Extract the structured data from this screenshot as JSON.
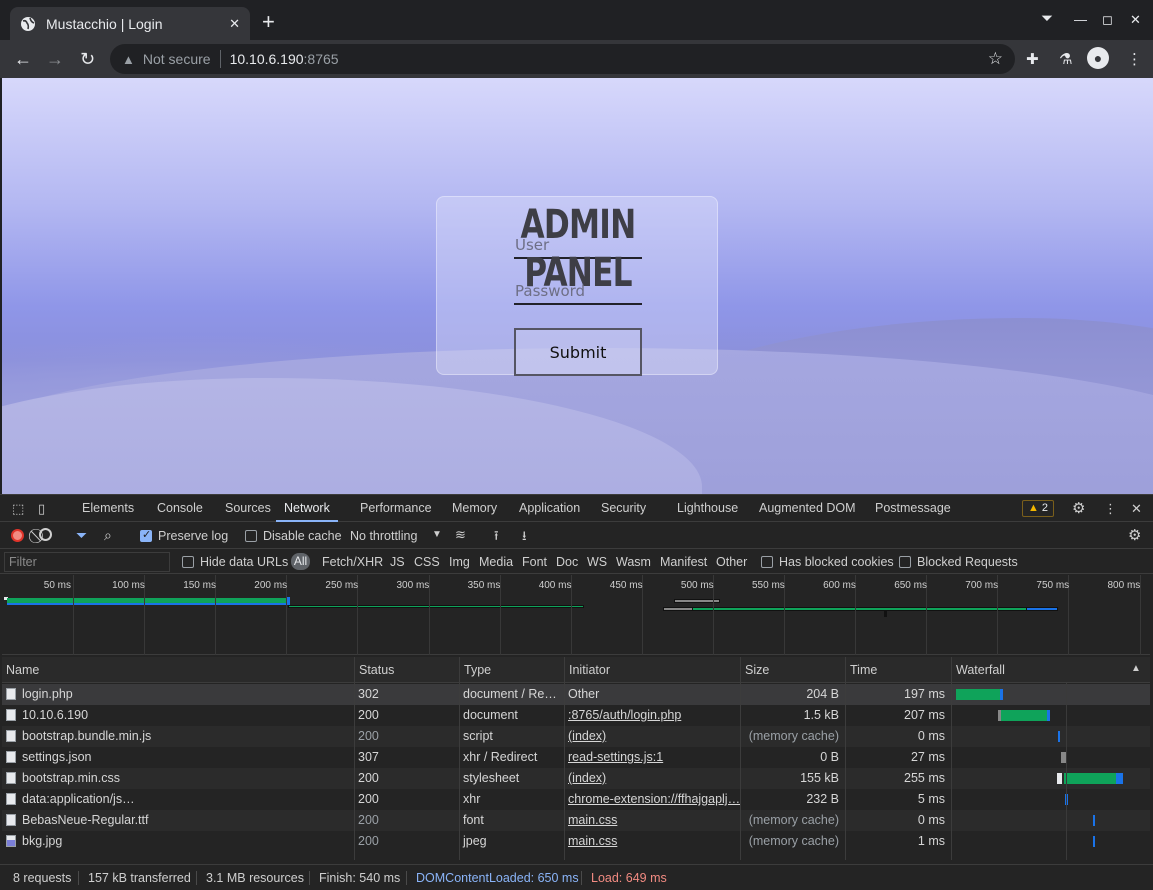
{
  "browser": {
    "tab_title": "Mustacchio | Login",
    "new_tab_label": "+",
    "security_label": "Not secure",
    "url_host": "10.10.6.190",
    "url_port": ":8765"
  },
  "login": {
    "title": "ADMIN PANEL",
    "user_placeholder": "User",
    "password_placeholder": "Password",
    "submit_label": "Submit"
  },
  "devtools": {
    "tabs": [
      "Elements",
      "Console",
      "Sources",
      "Network",
      "Performance",
      "Memory",
      "Application",
      "Security",
      "Lighthouse",
      "Augmented DOM",
      "Postmessage"
    ],
    "active_tab": "Network",
    "warning_count": "2",
    "toolbar": {
      "preserve_log": "Preserve log",
      "disable_cache": "Disable cache",
      "throttling": "No throttling"
    },
    "filter": {
      "placeholder": "Filter",
      "hide_data_urls": "Hide data URLs",
      "all": "All",
      "types": [
        "Fetch/XHR",
        "JS",
        "CSS",
        "Img",
        "Media",
        "Font",
        "Doc",
        "WS",
        "Wasm",
        "Manifest",
        "Other"
      ],
      "has_blocked_cookies": "Has blocked cookies",
      "blocked_requests": "Blocked Requests"
    },
    "overview_ticks": [
      "50 ms",
      "100 ms",
      "150 ms",
      "200 ms",
      "250 ms",
      "300 ms",
      "350 ms",
      "400 ms",
      "450 ms",
      "500 ms",
      "550 ms",
      "600 ms",
      "650 ms",
      "700 ms",
      "750 ms",
      "800 ms"
    ],
    "columns": [
      "Name",
      "Status",
      "Type",
      "Initiator",
      "Size",
      "Time",
      "Waterfall"
    ],
    "requests": [
      {
        "name": "login.php",
        "status": "302",
        "type": "document / Re…",
        "initiator": "Other",
        "size": "204 B",
        "time": "197 ms",
        "icon": "file"
      },
      {
        "name": "10.10.6.190",
        "status": "200",
        "type": "document",
        "initiator": ":8765/auth/login.php",
        "size": "1.5 kB",
        "time": "207 ms",
        "icon": "file"
      },
      {
        "name": "bootstrap.bundle.min.js",
        "status": "200",
        "type": "script",
        "initiator": "(index)",
        "size": "(memory cache)",
        "time": "0 ms",
        "icon": "file"
      },
      {
        "name": "settings.json",
        "status": "307",
        "type": "xhr / Redirect",
        "initiator": "read-settings.js:1",
        "size": "0 B",
        "time": "27 ms",
        "icon": "file"
      },
      {
        "name": "bootstrap.min.css",
        "status": "200",
        "type": "stylesheet",
        "initiator": "(index)",
        "size": "155 kB",
        "time": "255 ms",
        "icon": "file"
      },
      {
        "name": "data:application/js…",
        "status": "200",
        "type": "xhr",
        "initiator": "chrome-extension://ffhajgaplj…",
        "size": "232 B",
        "time": "5 ms",
        "icon": "file"
      },
      {
        "name": "BebasNeue-Regular.ttf",
        "status": "200",
        "type": "font",
        "initiator": "main.css",
        "size": "(memory cache)",
        "time": "0 ms",
        "icon": "file"
      },
      {
        "name": "bkg.jpg",
        "status": "200",
        "type": "jpeg",
        "initiator": "main.css",
        "size": "(memory cache)",
        "time": "1 ms",
        "icon": "image"
      }
    ],
    "summary": {
      "requests": "8 requests",
      "transferred": "157 kB transferred",
      "resources": "3.1 MB resources",
      "finish": "Finish: 540 ms",
      "dom_content_loaded": "DOMContentLoaded: 650 ms",
      "load": "Load: 649 ms"
    }
  }
}
